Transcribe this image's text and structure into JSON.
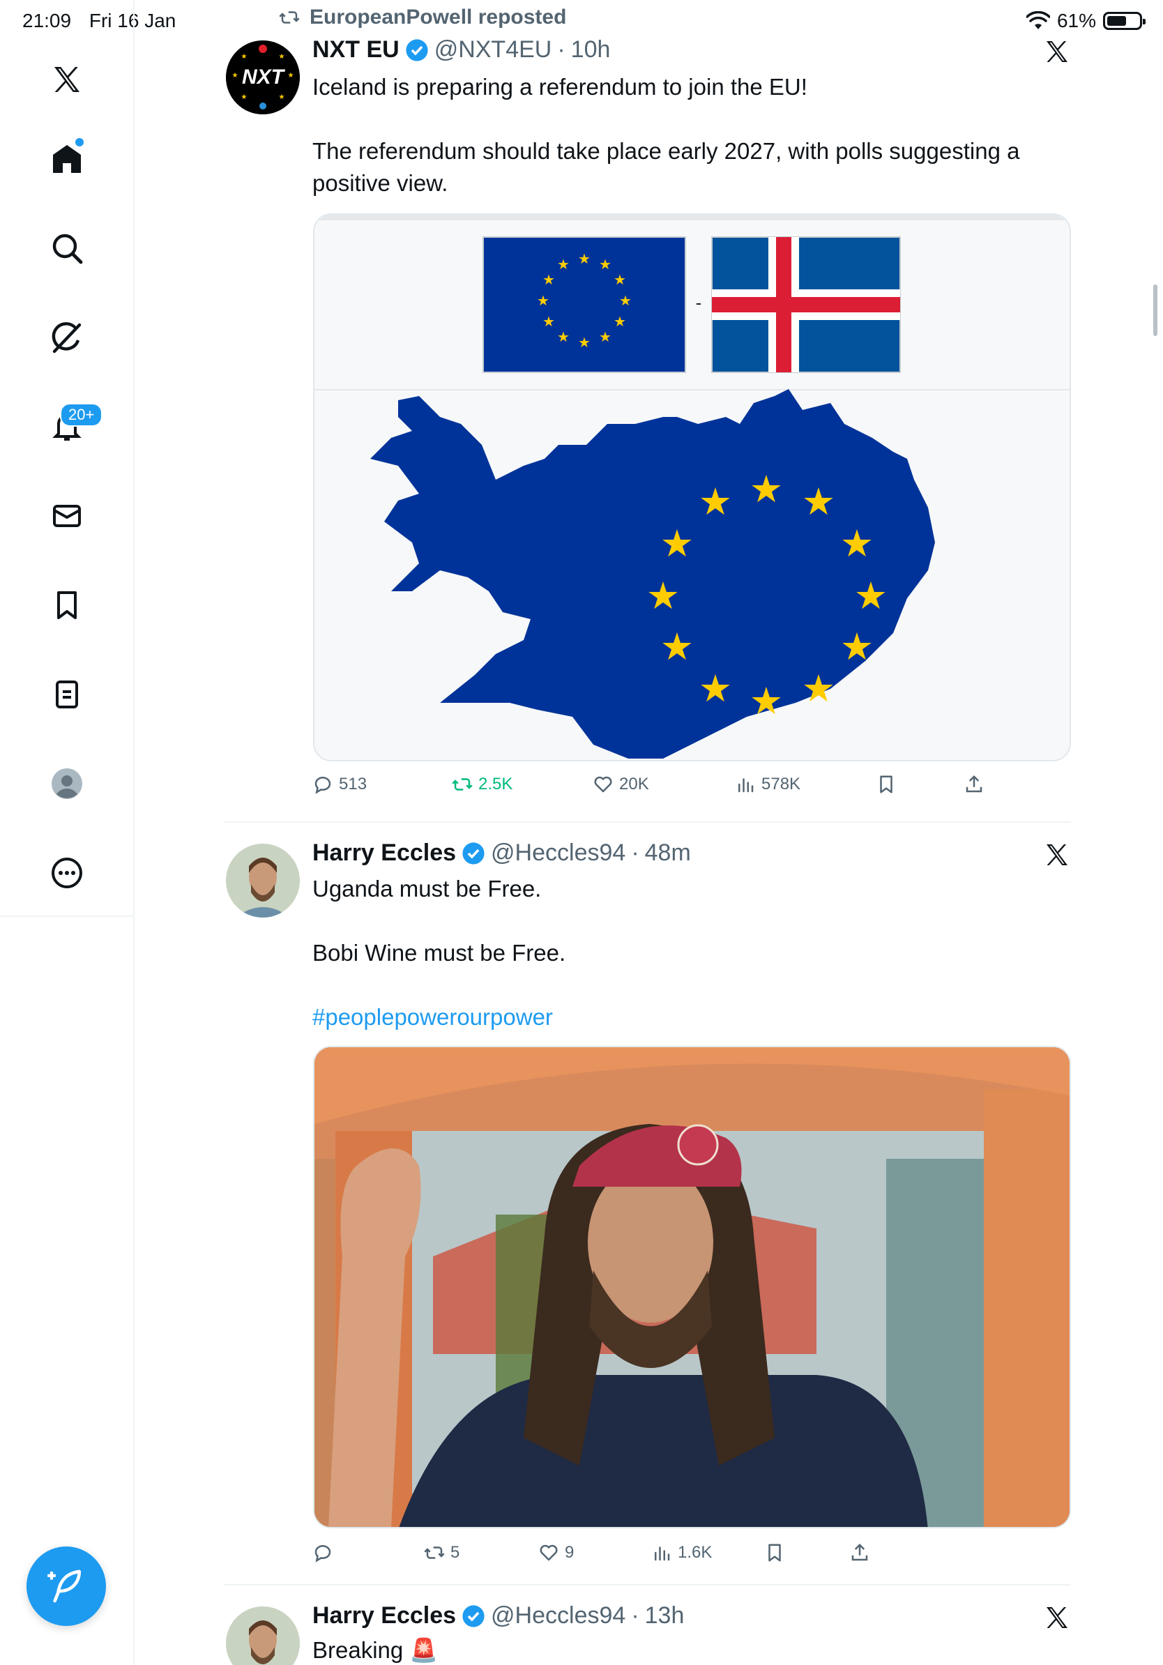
{
  "status": {
    "time": "21:09",
    "date": "Fri 16 Jan",
    "battery": "61%"
  },
  "sidebar": {
    "notifications_badge": "20+",
    "icons": [
      "x-logo-icon",
      "home-icon",
      "search-icon",
      "grok-icon",
      "notifications-icon",
      "messages-icon",
      "bookmarks-icon",
      "lists-icon",
      "profile-icon",
      "more-icon"
    ]
  },
  "tweets": [
    {
      "repost_label": "EuropeanPowell reposted",
      "name": "NXT EU",
      "handle": "@NXT4EU",
      "time": "10h",
      "text_lines": [
        "Iceland is preparing a referendum to join the EU!",
        "",
        "The referendum should take place early 2027, with polls suggesting a",
        "positive view."
      ],
      "stats": {
        "replies": "513",
        "reposts": "2.5K",
        "likes": "20K",
        "views": "578K"
      }
    },
    {
      "name": "Harry Eccles",
      "handle": "@Heccles94",
      "time": "48m",
      "text_lines": [
        "Uganda must be Free.",
        "",
        "Bobi Wine must be Free.",
        ""
      ],
      "hashtag": "#peoplepowerourpower",
      "stats": {
        "replies": "",
        "reposts": "5",
        "likes": "9",
        "views": "1.6K"
      }
    },
    {
      "name": "Harry Eccles",
      "handle": "@Heccles94",
      "time": "13h",
      "text": "Breaking 🚨"
    }
  ],
  "colors": {
    "accent": "#1d9bf0",
    "eu_blue": "#003399",
    "eu_star": "#ffcc00",
    "iceland_red": "#dc1e35",
    "repost_green": "#00ba7c"
  }
}
